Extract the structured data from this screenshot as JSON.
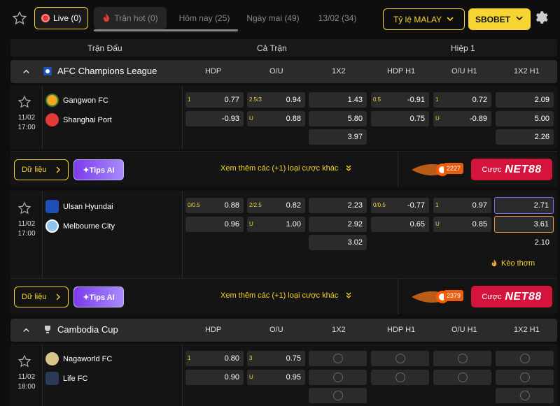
{
  "topbar": {
    "live_label": "Live",
    "live_count": "(0)",
    "hot_label": "Trận hot",
    "hot_count": "(0)",
    "today": "Hôm nay (25)",
    "tomorrow": "Ngày mai (49)",
    "date": "13/02 (34)",
    "odds_type": "Tỷ lệ MALAY",
    "bookmaker": "SBOBET"
  },
  "columns": {
    "match": "Trận Đấu",
    "full": "Cả Trận",
    "half": "Hiệp 1"
  },
  "market_headers": [
    "HDP",
    "O/U",
    "1X2",
    "HDP H1",
    "O/U H1",
    "1X2 H1"
  ],
  "colors": {
    "accent": "#f6d431",
    "live": "#e53935",
    "net88": "#d4143c",
    "tips": "#7c3aed"
  },
  "leagues": [
    {
      "name": "AFC Champions League",
      "matches": [
        {
          "date": "11/02",
          "time": "17:00",
          "home": "Gangwon FC",
          "away": "Shanghai Port",
          "hdp": [
            {
              "l": "1",
              "v": "0.77"
            },
            {
              "l": "",
              "v": "-0.93"
            }
          ],
          "ou": [
            {
              "l": "2.5/3",
              "v": "0.94"
            },
            {
              "l": "U",
              "v": "0.88"
            }
          ],
          "x12": [
            "1.43",
            "5.80",
            "3.97"
          ],
          "hdp1": [
            {
              "l": "0.5",
              "v": "-0.91"
            },
            {
              "l": "",
              "v": "0.75"
            }
          ],
          "ou1": [
            {
              "l": "1",
              "v": "0.72"
            },
            {
              "l": "U",
              "v": "-0.89"
            }
          ],
          "x12h1": [
            "2.09",
            "5.00",
            "2.26"
          ],
          "more": "Xem thêm các (+1) loại cược khác",
          "fire_count": "2227"
        },
        {
          "date": "11/02",
          "time": "17:00",
          "home": "Ulsan Hyundai",
          "away": "Melbourne City",
          "hdp": [
            {
              "l": "0/0.5",
              "v": "0.88"
            },
            {
              "l": "",
              "v": "0.96"
            }
          ],
          "ou": [
            {
              "l": "2/2.5",
              "v": "0.82"
            },
            {
              "l": "U",
              "v": "1.00"
            }
          ],
          "x12": [
            "2.23",
            "2.92",
            "3.02"
          ],
          "hdp1": [
            {
              "l": "0/0.5",
              "v": "-0.77"
            },
            {
              "l": "",
              "v": "0.65"
            }
          ],
          "ou1": [
            {
              "l": "1",
              "v": "0.97"
            },
            {
              "l": "U",
              "v": "0.85"
            }
          ],
          "x12h1": [
            "2.71",
            "3.61",
            "2.10"
          ],
          "hot_label": "Kèo thơm",
          "more": "Xem thêm các (+1) loại cược khác",
          "fire_count": "2379"
        }
      ]
    },
    {
      "name": "Cambodia Cup",
      "matches": [
        {
          "date": "11/02",
          "time": "18:00",
          "home": "Nagaworld FC",
          "away": "Life FC",
          "hdp": [
            {
              "l": "1",
              "v": "0.80"
            },
            {
              "l": "",
              "v": "0.90"
            }
          ],
          "ou": [
            {
              "l": "3",
              "v": "0.75"
            },
            {
              "l": "U",
              "v": "0.95"
            }
          ]
        }
      ]
    }
  ],
  "buttons": {
    "data": "Dữ liệu",
    "tips": "✦Tips AI",
    "bet": "Cược",
    "brand": "NET88"
  }
}
